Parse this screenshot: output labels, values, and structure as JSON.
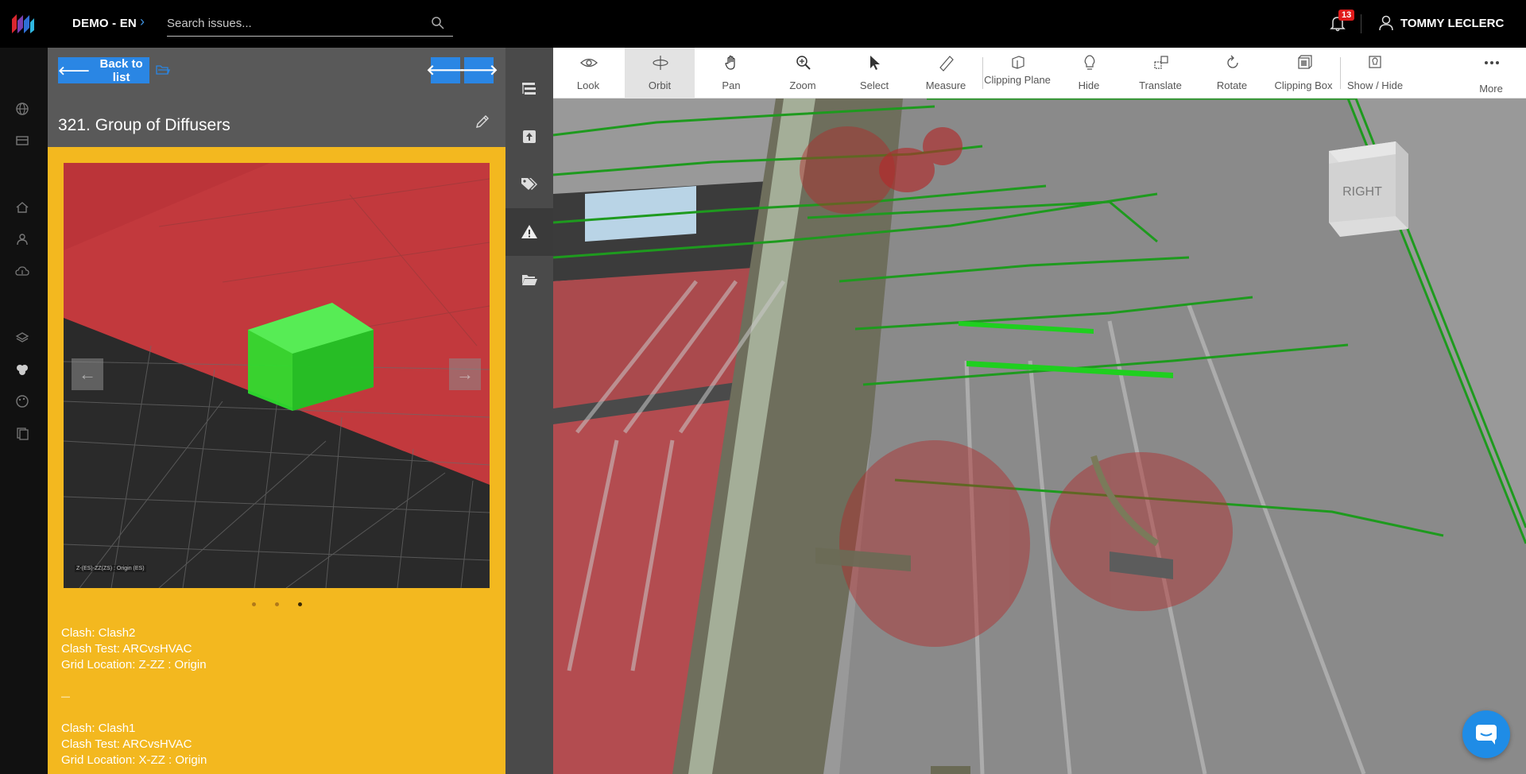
{
  "header": {
    "project": "DEMO - EN",
    "search_placeholder": "Search issues...",
    "notification_count": "13",
    "user_name": "TOMMY LECLERC"
  },
  "issue": {
    "back_label": "Back to list",
    "title": "321.  Group of Diffusers",
    "image_caption": "Z-(ES)-ZZ(ZS) : Origin (ES)",
    "slides": 3,
    "active_slide": 3,
    "description": [
      "Clash: Clash2",
      "Clash Test: ARCvsHVAC",
      "Grid Location: Z-ZZ : Origin",
      "—",
      "Clash: Clash1",
      "Clash Test: ARCvsHVAC",
      "Grid Location: X-ZZ : Origin"
    ]
  },
  "toolbar": {
    "items": [
      {
        "label": "Look",
        "icon": "eye-icon"
      },
      {
        "label": "Orbit",
        "icon": "orbit-icon"
      },
      {
        "label": "Pan",
        "icon": "hand-icon"
      },
      {
        "label": "Zoom",
        "icon": "zoom-icon"
      },
      {
        "label": "Select",
        "icon": "cursor-icon"
      },
      {
        "label": "Measure",
        "icon": "ruler-icon"
      },
      {
        "label": "Clipping Plane",
        "icon": "clipping-plane-icon"
      },
      {
        "label": "Hide",
        "icon": "bulb-icon"
      },
      {
        "label": "Translate",
        "icon": "translate-icon"
      },
      {
        "label": "Rotate",
        "icon": "rotate-icon"
      },
      {
        "label": "Clipping Box",
        "icon": "clipping-box-icon"
      },
      {
        "label": "Show / Hide",
        "icon": "show-hide-icon"
      },
      {
        "label": "More",
        "icon": "more-icon"
      }
    ],
    "active": "Orbit"
  },
  "viewcube": {
    "face": "RIGHT"
  },
  "colors": {
    "accent": "#2a86e4",
    "issue_panel": "#f3b81f",
    "panel_header": "#595959",
    "clash_green": "#22cc22",
    "clash_red": "#b83232"
  }
}
